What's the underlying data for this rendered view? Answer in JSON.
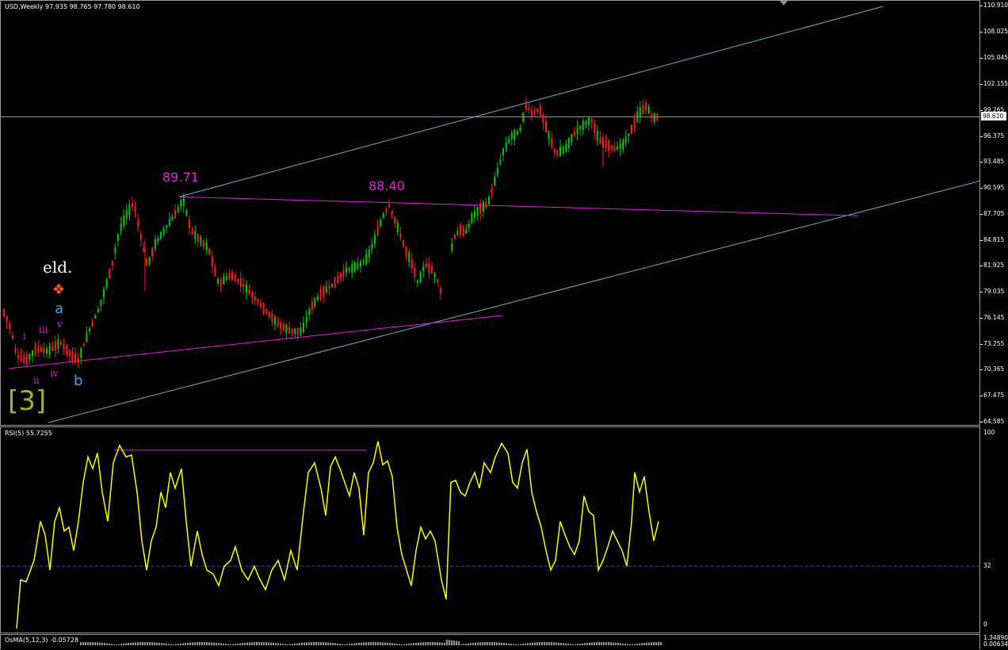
{
  "header": {
    "main": "USD,Weekly  97.935 98.765 97.780 98.610",
    "rsi": "RSI(5) 55.7255",
    "osma": "OsMA(5,12,3) -0.05728"
  },
  "colors": {
    "bull_candle": "#00cc00",
    "bear_candle": "#ff1a1a",
    "channel": "#5fb8c8",
    "magenta": "#e020e0",
    "rsi_line": "#ffff00",
    "level32": "#5a3aa8"
  },
  "annotations": {
    "high1": "89.71",
    "high2": "88.40",
    "eld": "eld.",
    "eld_symbol": "❖",
    "wave_a": "a",
    "wave_b": "b",
    "wave_i": "i",
    "wave_ii": "ii",
    "wave_iii": "iii",
    "wave_iv": "iv",
    "wave_v": "v",
    "wave3": "[3]"
  },
  "price_axis": {
    "ticks": [
      "110.910",
      "108.025",
      "105.045",
      "102.155",
      "99.265",
      "96.375",
      "93.485",
      "90.595",
      "87.705",
      "84.815",
      "81.925",
      "79.035",
      "76.145",
      "73.255",
      "70.365",
      "67.475",
      "64.585"
    ],
    "current_price": "98.610"
  },
  "rsi_axis": {
    "ticks": [
      "100",
      "32",
      "0"
    ]
  },
  "osma_axis": {
    "ticks": [
      "1.34890",
      "0.00634"
    ]
  },
  "chart_data": [
    {
      "type": "candlestick",
      "title": "USD,Weekly",
      "ylim": [
        64.585,
        110.91
      ],
      "current_price": 98.61,
      "labels": [
        "89.71",
        "88.40"
      ],
      "key_levels": {
        "high1": 89.71,
        "high2": 88.4
      }
    },
    {
      "type": "line",
      "title": "RSI(5) 55.7255",
      "ylim": [
        0,
        100
      ],
      "level": 32
    },
    {
      "type": "bar",
      "title": "OsMA(5,12,3) -0.05728"
    }
  ]
}
